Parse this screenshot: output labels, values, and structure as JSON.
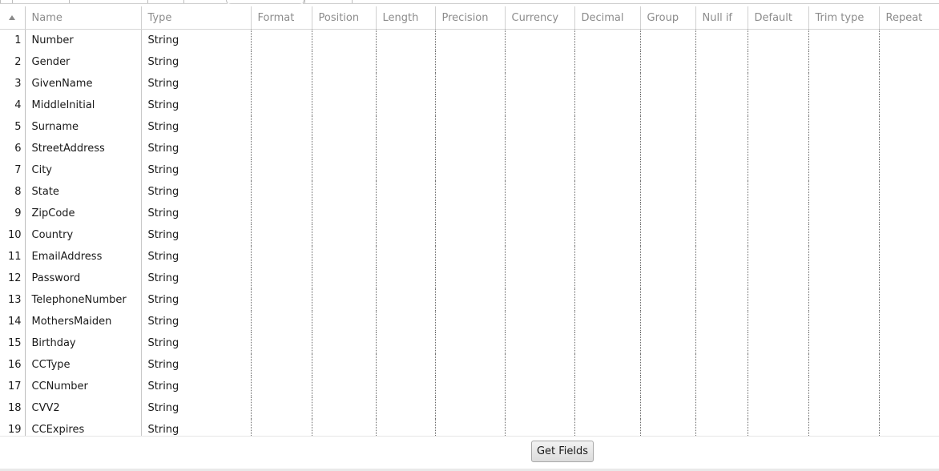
{
  "grid": {
    "columns": [
      "Name",
      "Type",
      "Format",
      "Position",
      "Length",
      "Precision",
      "Currency",
      "Decimal",
      "Group",
      "Null if",
      "Default",
      "Trim type",
      "Repeat"
    ],
    "rows": [
      {
        "index": "1",
        "name": "Number",
        "type": "String"
      },
      {
        "index": "2",
        "name": "Gender",
        "type": "String"
      },
      {
        "index": "3",
        "name": "GivenName",
        "type": "String"
      },
      {
        "index": "4",
        "name": "MiddleInitial",
        "type": "String"
      },
      {
        "index": "5",
        "name": "Surname",
        "type": "String"
      },
      {
        "index": "6",
        "name": "StreetAddress",
        "type": "String"
      },
      {
        "index": "7",
        "name": "City",
        "type": "String"
      },
      {
        "index": "8",
        "name": "State",
        "type": "String"
      },
      {
        "index": "9",
        "name": "ZipCode",
        "type": "String"
      },
      {
        "index": "10",
        "name": "Country",
        "type": "String"
      },
      {
        "index": "11",
        "name": "EmailAddress",
        "type": "String"
      },
      {
        "index": "12",
        "name": "Password",
        "type": "String"
      },
      {
        "index": "13",
        "name": "TelephoneNumber",
        "type": "String"
      },
      {
        "index": "14",
        "name": "MothersMaiden",
        "type": "String"
      },
      {
        "index": "15",
        "name": "Birthday",
        "type": "String"
      },
      {
        "index": "16",
        "name": "CCType",
        "type": "String"
      },
      {
        "index": "17",
        "name": "CCNumber",
        "type": "String"
      },
      {
        "index": "18",
        "name": "CVV2",
        "type": "String"
      },
      {
        "index": "19",
        "name": "CCExpires",
        "type": "String"
      }
    ]
  },
  "footer": {
    "get_fields_label": "Get Fields"
  },
  "icons": {
    "sort": "sort-ascending-icon"
  }
}
